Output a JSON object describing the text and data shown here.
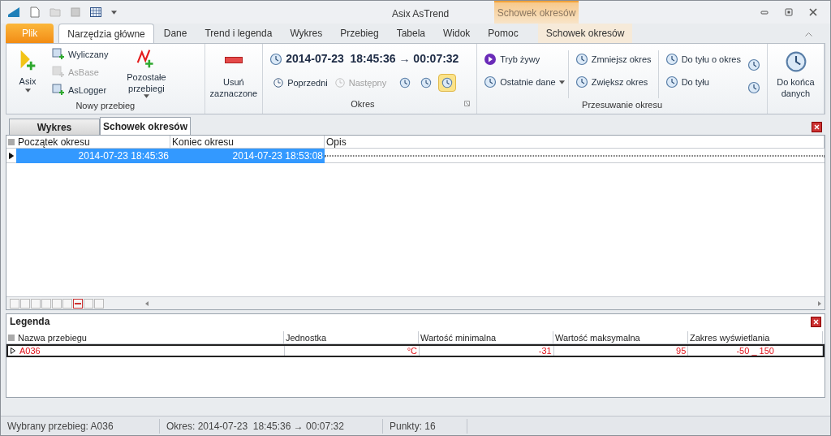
{
  "window": {
    "title": "Asix AsTrend",
    "context_title": "Schowek okresów"
  },
  "ribbon_tabs": [
    {
      "label": "Plik",
      "kind": "file",
      "selected": false
    },
    {
      "label": "Narzędzia główne",
      "kind": "normal",
      "selected": true
    },
    {
      "label": "Dane",
      "kind": "normal",
      "selected": false
    },
    {
      "label": "Trend i legenda",
      "kind": "normal",
      "selected": false
    },
    {
      "label": "Wykres",
      "kind": "normal",
      "selected": false
    },
    {
      "label": "Przebieg",
      "kind": "normal",
      "selected": false
    },
    {
      "label": "Tabela",
      "kind": "normal",
      "selected": false
    },
    {
      "label": "Widok",
      "kind": "normal",
      "selected": false
    },
    {
      "label": "Pomoc",
      "kind": "normal",
      "selected": false
    },
    {
      "label": "Schowek okresów",
      "kind": "contextual",
      "selected": false
    }
  ],
  "group_nowy": {
    "label": "Nowy przebieg",
    "asix": "Asix",
    "small": [
      {
        "label": "Wyliczany",
        "disabled": false
      },
      {
        "label": "AsBase",
        "disabled": true
      },
      {
        "label": "AsLogger",
        "disabled": false
      }
    ],
    "other": "Pozostałe przebiegi",
    "remove": "Usuń zaznaczone"
  },
  "group_okres": {
    "label": "Okres",
    "period": "2014-07-23  18:45:36 → 00:07:32",
    "nav": [
      {
        "label": "Poprzedni",
        "disabled": false
      },
      {
        "label": "Następny",
        "disabled": true
      }
    ],
    "toggles": [
      {
        "selected": false
      },
      {
        "selected": false
      },
      {
        "selected": true
      }
    ]
  },
  "group_przesuwanie": {
    "label": "Przesuwanie okresu",
    "col1": [
      "Tryb żywy",
      "Ostatnie dane"
    ],
    "col2": [
      "Zmniejsz okres",
      "Zwiększ okres"
    ],
    "col3": [
      "Do tyłu o okres",
      "Do tyłu"
    ],
    "end": "Do końca danych"
  },
  "doc_tabs": [
    {
      "label": "Wykres",
      "selected": false
    },
    {
      "label": "Schowek okresów",
      "selected": true
    }
  ],
  "periods": {
    "columns": [
      "Początek okresu",
      "Koniec okresu",
      "Opis"
    ],
    "rows": [
      {
        "selected": true,
        "cells": [
          "2014-07-23 18:45:36",
          "2014-07-23 18:53:08",
          ""
        ]
      }
    ]
  },
  "legend": {
    "title": "Legenda",
    "columns": [
      "Nazwa przebiegu",
      "Jednostka",
      "Wartość minimalna",
      "Wartość maksymalna",
      "Zakres wyświetlania"
    ],
    "rows": [
      {
        "color": "#e0121a",
        "cells": [
          "A036",
          "°C",
          "-31",
          "95",
          "-50 _ 150"
        ]
      }
    ]
  },
  "status_bar": [
    "Wybrany przebieg: A036",
    "Okres: 2014-07-23  18:45:36 → 00:07:32",
    "Punkty: 16"
  ]
}
